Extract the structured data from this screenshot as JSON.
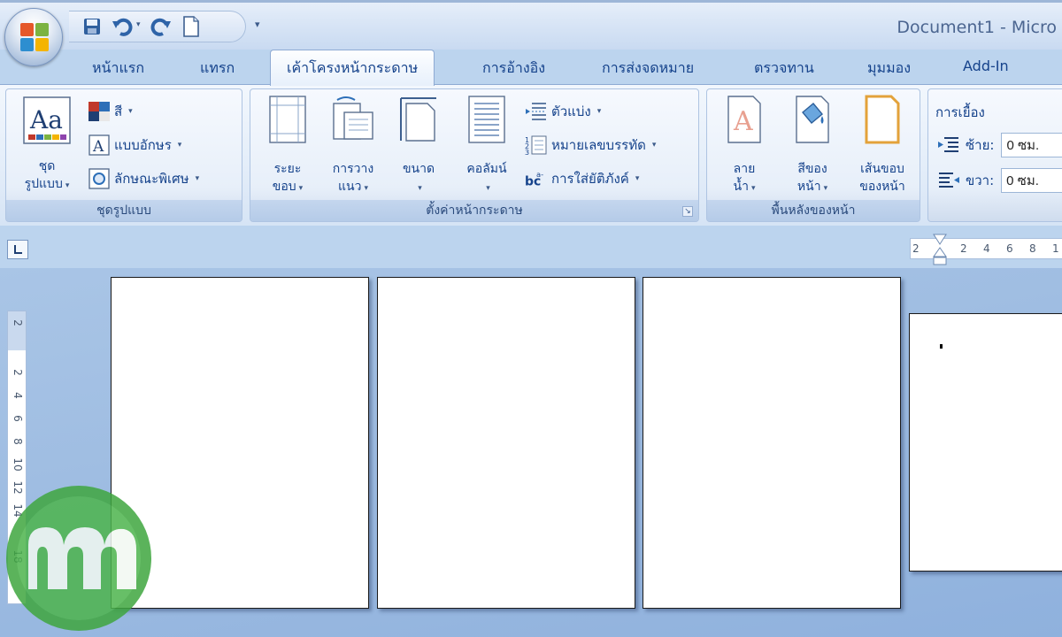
{
  "window": {
    "title": "Document1 - Micro"
  },
  "tabs": [
    {
      "label": "หน้าแรก",
      "active": false
    },
    {
      "label": "แทรก",
      "active": false
    },
    {
      "label": "เค้าโครงหน้ากระดาษ",
      "active": true
    },
    {
      "label": "การอ้างอิง",
      "active": false
    },
    {
      "label": "การส่งจดหมาย",
      "active": false
    },
    {
      "label": "ตรวจทาน",
      "active": false
    },
    {
      "label": "มุมมอง",
      "active": false
    },
    {
      "label": "Add-In",
      "active": false
    }
  ],
  "groups": {
    "themes": {
      "label": "ชุดรูปแบบ",
      "themes_btn": {
        "line1": "ชุด",
        "line2": "รูปแบบ"
      },
      "colors": "สี",
      "fonts": "แบบอักษร",
      "effects": "ลักษณะพิเศษ"
    },
    "page_setup": {
      "label": "ตั้งค่าหน้ากระดาษ",
      "margins": {
        "line1": "ระยะ",
        "line2": "ขอบ"
      },
      "orientation": {
        "line1": "การวาง",
        "line2": "แนว"
      },
      "size": {
        "line1": "ขนาด"
      },
      "columns": {
        "line1": "คอลัมน์"
      },
      "breaks": "ตัวแบ่ง",
      "line_numbers": "หมายเลขบรรทัด",
      "hyphenation": "การใส่ยัติภังค์"
    },
    "page_background": {
      "label": "พื้นหลังของหน้า",
      "watermark": {
        "line1": "ลาย",
        "line2": "น้ำ"
      },
      "page_color": {
        "line1": "สีของ",
        "line2": "หน้า"
      },
      "page_borders": {
        "line1": "เส้นขอบ",
        "line2": "ของหน้า"
      }
    },
    "paragraph": {
      "indent_title": "การเยื้อง",
      "left_label": "ซ้าย:",
      "left_value": "0 ซม.",
      "right_label": "ขวา:",
      "right_value": "0 ซม."
    }
  },
  "hruler": {
    "ticks": [
      "2",
      "2",
      "4",
      "6",
      "8",
      "1"
    ]
  },
  "vruler": {
    "ticks": [
      "2",
      "2",
      "4",
      "6",
      "8",
      "10",
      "12",
      "14",
      "18"
    ]
  },
  "colors": {
    "accent": "#15428b",
    "ribbon": "#dfe9f5",
    "workspace": "#9fbde2"
  },
  "icons": [
    "office-logo-icon",
    "save-icon",
    "undo-icon",
    "redo-icon",
    "new-document-icon"
  ]
}
